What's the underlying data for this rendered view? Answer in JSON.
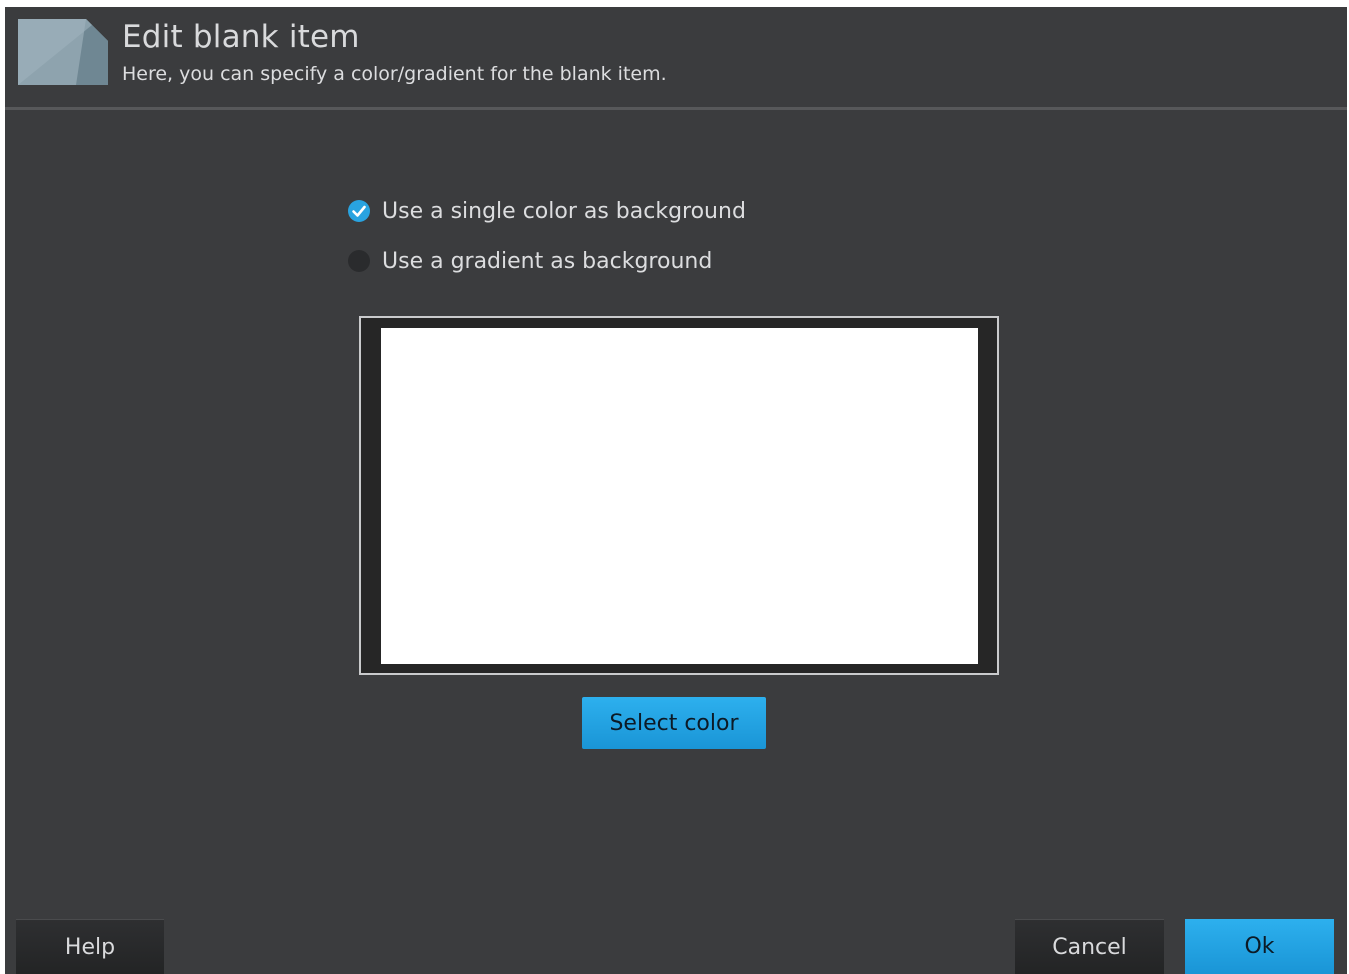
{
  "header": {
    "title": "Edit blank item",
    "subtitle": "Here, you can specify a color/gradient for the blank item.",
    "icon": "page-corner-icon"
  },
  "options": [
    {
      "label": "Use a single color as background",
      "checked": true
    },
    {
      "label": "Use a gradient as background",
      "checked": false
    }
  ],
  "preview": {
    "color": "#ffffff"
  },
  "buttons": {
    "select_color": "Select color",
    "help": "Help",
    "cancel": "Cancel",
    "ok": "Ok"
  },
  "colors": {
    "accent": "#29a3e0",
    "background": "#3b3c3e"
  }
}
